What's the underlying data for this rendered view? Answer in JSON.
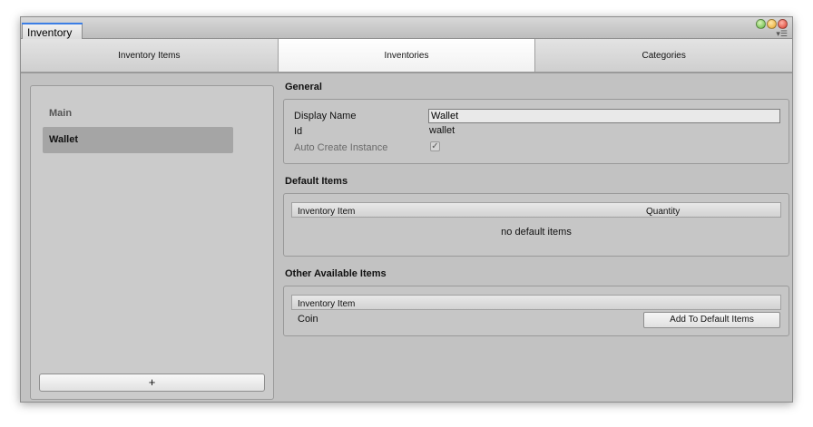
{
  "window": {
    "tab_label": "Inventory",
    "menu_glyph": "▾☰"
  },
  "tabs": [
    {
      "label": "Inventory Items",
      "active": false
    },
    {
      "label": "Inventories",
      "active": true
    },
    {
      "label": "Categories",
      "active": false
    }
  ],
  "sidebar": {
    "items": [
      {
        "label": "Main",
        "selected": false
      },
      {
        "label": "Wallet",
        "selected": true
      }
    ],
    "add_label": "+"
  },
  "general": {
    "title": "General",
    "display_name_label": "Display Name",
    "display_name_value": "Wallet",
    "id_label": "Id",
    "id_value": "wallet",
    "auto_create_label": "Auto Create Instance",
    "auto_create_checked": true,
    "check_glyph": "✓"
  },
  "default_items": {
    "title": "Default Items",
    "col_item": "Inventory Item",
    "col_quantity": "Quantity",
    "empty_message": "no default items"
  },
  "other_items": {
    "title": "Other Available Items",
    "col_item": "Inventory Item",
    "rows": [
      {
        "name": "Coin",
        "action_label": "Add To Default Items"
      }
    ]
  },
  "colors": {
    "selected_row": "#a5a5a5",
    "focus_accent": "#3b7ee5",
    "window_bg": "#c2c2c2"
  }
}
